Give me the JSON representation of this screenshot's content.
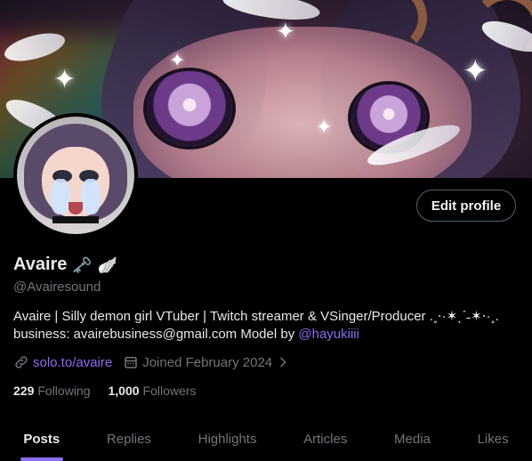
{
  "profile": {
    "display_name": "Avaire",
    "name_emoji": [
      "🗝️",
      "🪽"
    ],
    "handle": "@Avairesound",
    "edit_profile_label": "Edit profile",
    "bio_text": "Avaire | Silly demon girl VTuber | Twitch streamer & VSinger/Producer .˳⋅·✶ˎˊ˗✶⋅·˳.",
    "bio_line2_prefix": "business: avairebusiness@gmail.com Model by ",
    "bio_mention": "@hayukiiii",
    "website": "solo.to/avaire",
    "joined": "Joined February 2024"
  },
  "stats": {
    "following_count": "229",
    "following_label": "Following",
    "followers_count": "1,000",
    "followers_label": "Followers"
  },
  "tabs": [
    {
      "label": "Posts",
      "active": true
    },
    {
      "label": "Replies",
      "active": false
    },
    {
      "label": "Highlights",
      "active": false
    },
    {
      "label": "Articles",
      "active": false
    },
    {
      "label": "Media",
      "active": false
    },
    {
      "label": "Likes",
      "active": false
    }
  ],
  "icons": {
    "link": "link-icon",
    "calendar": "calendar-icon",
    "chevron": "chevron-right-icon"
  },
  "colors": {
    "background": "#000000",
    "text_primary": "#e7e9ea",
    "text_secondary": "#71767b",
    "accent": "#8c6cf0",
    "button_border": "#536471"
  }
}
